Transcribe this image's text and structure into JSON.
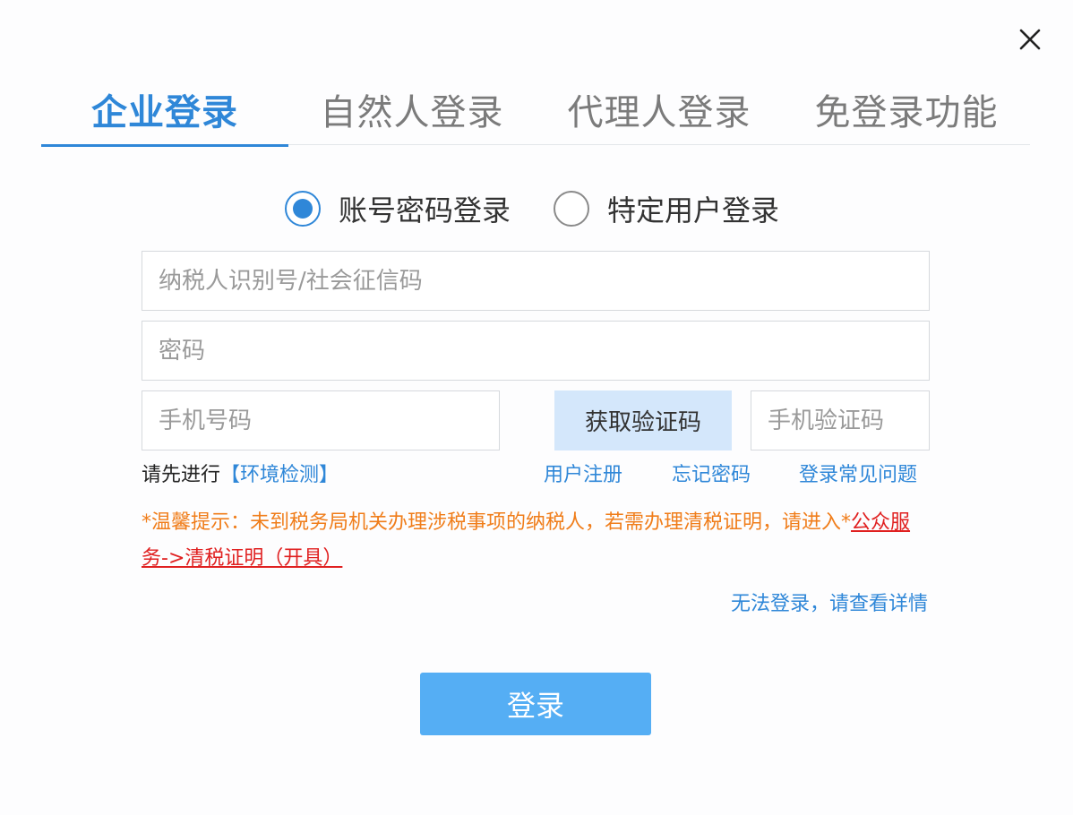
{
  "tabs": [
    {
      "label": "企业登录",
      "active": true
    },
    {
      "label": "自然人登录",
      "active": false
    },
    {
      "label": "代理人登录",
      "active": false
    },
    {
      "label": "免登录功能",
      "active": false
    }
  ],
  "login_mode": {
    "options": [
      {
        "label": "账号密码登录",
        "checked": true
      },
      {
        "label": "特定用户登录",
        "checked": false
      }
    ]
  },
  "form": {
    "taxpayer_id_placeholder": "纳税人识别号/社会征信码",
    "password_placeholder": "密码",
    "phone_placeholder": "手机号码",
    "sms_button_label": "获取验证码",
    "sms_code_placeholder": "手机验证码"
  },
  "links": {
    "env_prefix": "请先进行",
    "env_check": "【环境检测】",
    "register": "用户注册",
    "forgot_password": "忘记密码",
    "faq": "登录常见问题"
  },
  "notice": {
    "text": "*温馨提示：未到税务局机关办理涉税事项的纳税人，若需办理清税证明，请进入*",
    "link": "公众服务->清税证明（开具）"
  },
  "cannot_login": "无法登录，请查看详情",
  "login_button": "登录",
  "colors": {
    "accent": "#2f87d8",
    "login_button": "#55aef4",
    "sms_button_bg": "#d4e7fb",
    "notice": "#f07d1a",
    "notice_link": "#e02020"
  }
}
